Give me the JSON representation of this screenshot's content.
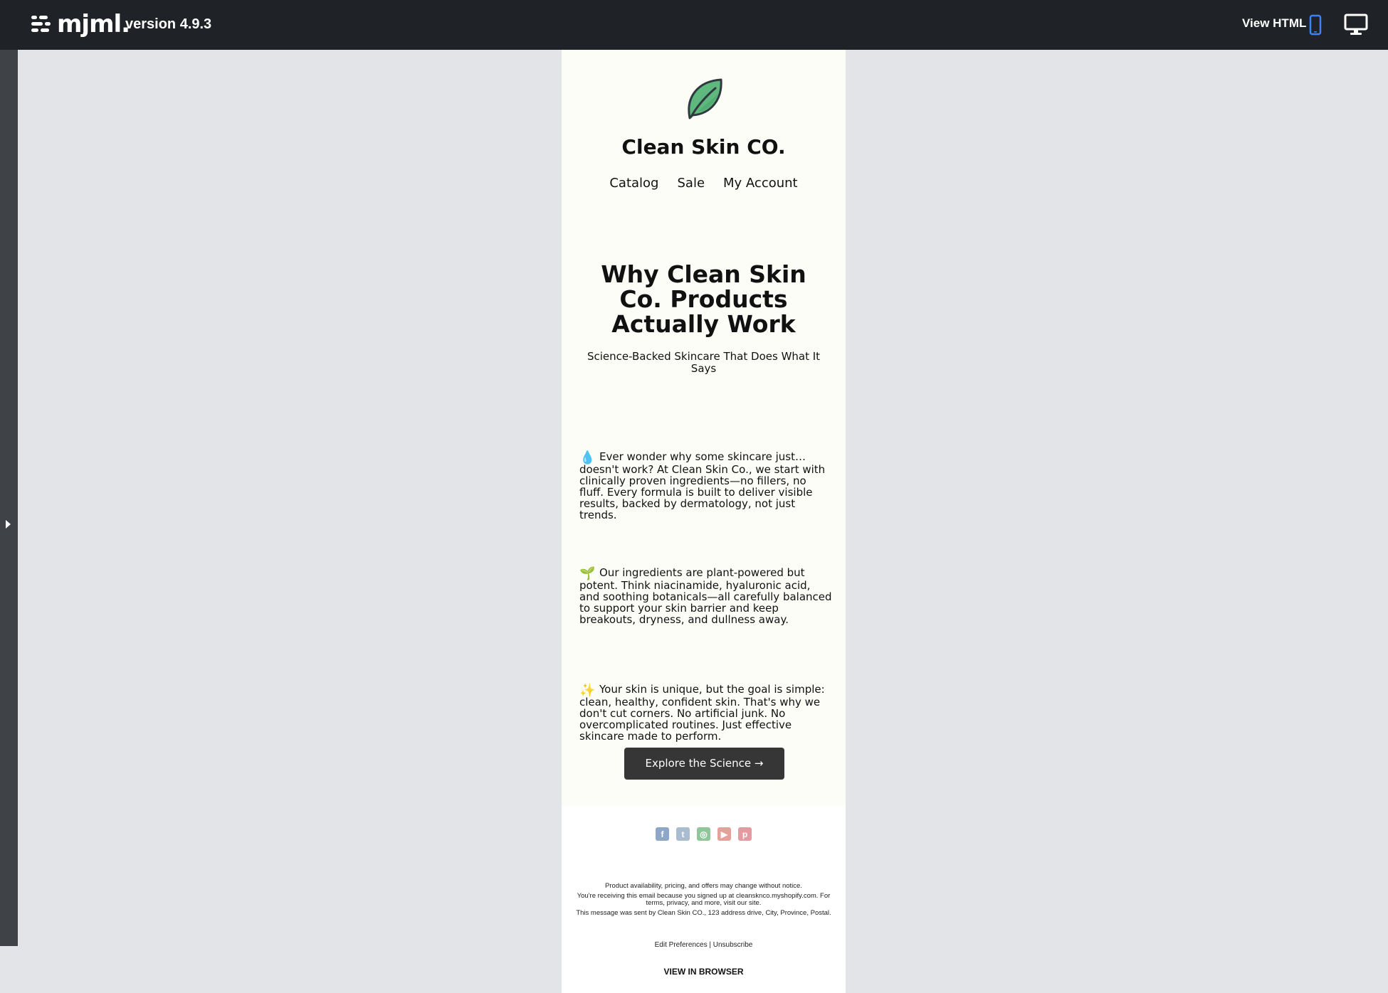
{
  "app": {
    "logo_text": "mjml.",
    "version": "version 4.9.3",
    "view_html_label": "View HTML",
    "mobile_icon": "mobile-icon",
    "desktop_icon": "desktop-icon",
    "accent_color": "#3b82f6"
  },
  "email": {
    "logo_icon": "leaf-icon",
    "brand": "Clean Skin CO.",
    "nav": [
      "Catalog",
      "Sale",
      "My Account"
    ],
    "headline": "Why Clean Skin Co. Products Actually Work",
    "subhead": "Science-Backed Skincare That Does What It Says",
    "paragraphs": [
      {
        "emoji": "💧",
        "text": "Ever wonder why some skincare just… doesn't work? At Clean Skin Co., we start with clinically proven ingredients—no fillers, no fluff. Every formula is built to deliver visible results, backed by dermatology, not just trends."
      },
      {
        "emoji": "🌱",
        "text": "Our ingredients are plant-powered but potent. Think niacinamide, hyaluronic acid, and soothing botanicals—all carefully balanced to support your skin barrier and keep breakouts, dryness, and dullness away."
      },
      {
        "emoji": "✨",
        "text": "Your skin is unique, but the goal is simple: clean, healthy, confident skin. That's why we don't cut corners. No artificial junk. No overcomplicated routines. Just effective skincare made to perform."
      }
    ],
    "cta_label": "Explore the Science →",
    "socials": [
      {
        "name": "facebook-icon",
        "glyph": "f",
        "color": "#8ea7c9"
      },
      {
        "name": "twitter-icon",
        "glyph": "t",
        "color": "#a9bcd0"
      },
      {
        "name": "instagram-icon",
        "glyph": "◎",
        "color": "#8fc79a"
      },
      {
        "name": "youtube-icon",
        "glyph": "▶",
        "color": "#e3a29a"
      },
      {
        "name": "pinterest-icon",
        "glyph": "p",
        "color": "#e49aa0"
      }
    ],
    "footer": {
      "line1": "Product availability, pricing, and offers may change without notice.",
      "line2": "You're receiving this email because you signed up at cleansknco.myshopify.com. For terms, privacy, and more, visit our site.",
      "line3": "This message was sent by Clean Skin CO., 123 address drive, City, Province, Postal.",
      "edit_prefs": "Edit Preferences",
      "separator": "|",
      "unsubscribe": "Unsubscribe",
      "view_in_browser": "VIEW IN BROWSER"
    }
  }
}
